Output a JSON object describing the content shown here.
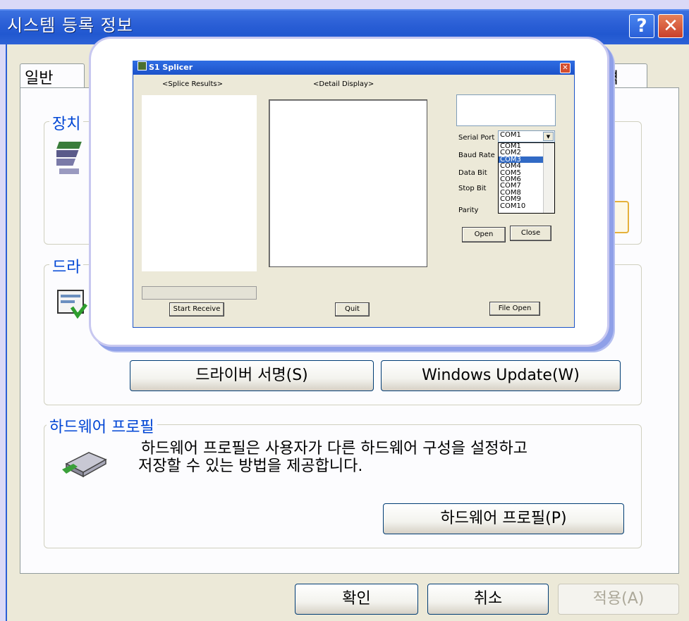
{
  "outer_window": {
    "title": "시스템 등록 정보",
    "help_symbol": "?",
    "close_symbol": "✕",
    "tabs": [
      "일반",
      "격"
    ]
  },
  "device_group": {
    "label": "장치"
  },
  "driver_group": {
    "label": "드라",
    "driver_sign_button": "드라이버 서명(S)",
    "windows_update_button": "Windows Update(W)"
  },
  "hw_profile_group": {
    "label": "하드웨어 프로필",
    "description_line1": "하드웨어 프로필은 사용자가 다른 하드웨어 구성을 설정하고",
    "description_line2": "저장할 수 있는 방법을 제공합니다.",
    "button": "하드웨어 프로필(P)"
  },
  "footer": {
    "ok": "확인",
    "cancel": "취소",
    "apply": "적용(A)"
  },
  "app": {
    "title": "S1 Splicer",
    "close_symbol": "✕",
    "splice_results_label": "<Splice Results>",
    "detail_display_label": "<Detail Display>",
    "serial_port_label": "Serial Port",
    "baud_rate_label": "Baud Rate",
    "data_bit_label": "Data Bit",
    "stop_bit_label": "Stop Bit",
    "parity_label": "Parity",
    "serial_port_value": "COM1",
    "serial_port_options": [
      "COM1",
      "COM2",
      "COM3",
      "COM4",
      "COM5",
      "COM6",
      "COM7",
      "COM8",
      "COM9",
      "COM10"
    ],
    "highlighted_option": "COM3",
    "open_button": "Open",
    "close_button": "Close",
    "start_receive_button": "Start Receive",
    "quit_button": "Quit",
    "file_open_button": "File Open"
  },
  "icons": [
    "device-manager-icon",
    "driver-icon",
    "hardware-profile-icon",
    "app-icon",
    "dropdown-arrow-icon"
  ]
}
